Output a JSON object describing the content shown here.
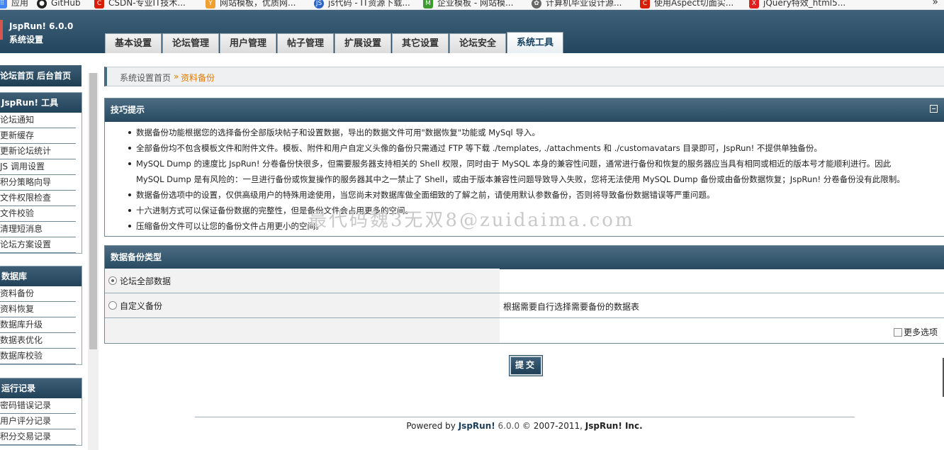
{
  "bookmarks": [
    {
      "label": "应用",
      "icon": "apps-icon",
      "color": "#4285f4"
    },
    {
      "label": "GitHub",
      "icon": "github-icon",
      "color": "#222222"
    },
    {
      "label": "CSDN-专业IT技术...",
      "icon": "csdn-icon",
      "color": "#d81e06"
    },
    {
      "label": "网站模板，优质网...",
      "icon": "template-icon",
      "color": "#f0a030"
    },
    {
      "label": "js代码 - IT资源下载...",
      "icon": "js-icon",
      "color": "#2b63c6"
    },
    {
      "label": "企业模板 - 网站模...",
      "icon": "m-icon",
      "color": "#3c9a2f"
    },
    {
      "label": "计算机毕业设计源...",
      "icon": "gear-icon",
      "color": "#666666"
    },
    {
      "label": "使用Aspect切面实...",
      "icon": "csdn-icon",
      "color": "#d81e06"
    },
    {
      "label": "jQuery特效_html5...",
      "icon": "jquery-icon",
      "color": "#e0201d"
    }
  ],
  "header": {
    "title": "JspRun! 6.0.0",
    "subtitle": "系统设置"
  },
  "tabs": [
    {
      "label": "基本设置",
      "active": false
    },
    {
      "label": "论坛管理",
      "active": false
    },
    {
      "label": "用户管理",
      "active": false
    },
    {
      "label": "帖子管理",
      "active": false
    },
    {
      "label": "扩展设置",
      "active": false
    },
    {
      "label": "其它设置",
      "active": false
    },
    {
      "label": "论坛安全",
      "active": false
    },
    {
      "label": "系统工具",
      "active": true
    }
  ],
  "sidebar": {
    "top_links": "论坛首页 后台首页",
    "sections": [
      {
        "title": "JspRun! 工具",
        "items": [
          "论坛通知",
          "更新缓存",
          "更新论坛统计",
          "JS 调用设置",
          "积分策略向导",
          "文件权限检查",
          "文件校验",
          "清理短消息",
          "论坛方案设置"
        ]
      },
      {
        "title": "数据库",
        "items": [
          "资料备份",
          "资料恢复",
          "数据库升级",
          "数据表优化",
          "数据库校验"
        ]
      },
      {
        "title": "运行记录",
        "items": [
          "密码错误记录",
          "用户评分记录",
          "积分交易记录"
        ]
      }
    ]
  },
  "breadcrumb": {
    "home": "系统设置首页",
    "separator": "»",
    "current": "资料备份"
  },
  "tips": {
    "title": "技巧提示",
    "items": [
      "数据备份功能根据您的选择备份全部版块帖子和设置数据，导出的数据文件可用\"数据恢复\"功能或 MySql 导入。",
      "全部备份均不包含模板文件和附件文件。模板、附件和用户自定义头像的备份只需通过 FTP 等下载 ./templates, ./attachments 和 ./customavatars 目录即可，JspRun! 不提供单独备份。",
      "MySQL Dump 的速度比 JspRun! 分卷备份快很多，但需要服务器支持相关的 Shell 权限，同时由于 MySQL 本身的兼容性问题，通常进行备份和恢复的服务器应当具有相同或相近的版本号才能顺利进行。因此",
      "数据备份选项中的设置，仅供高级用户的特殊用途使用，当您尚未对数据库做全面细致的了解之前，请使用默认参数备份，否则将导致备份数据错误等严重问题。",
      "十六进制方式可以保证备份数据的完整性，但是备份文件会占用更多的空间。",
      "压缩备份文件可以让您的备份文件占用更小的空间。"
    ],
    "item3_line2": "MySQL Dump 是有风险的：一旦进行备份或恢复操作的服务器其中之一禁止了 Shell，或由于版本兼容性问题导致导入失败，您将无法使用 MySQL Dump 备份或由备份数据恢复；JspRun! 分卷备份没有此限制。"
  },
  "backup": {
    "title": "数据备份类型",
    "options": [
      {
        "label": "论坛全部数据",
        "desc": "",
        "checked": true
      },
      {
        "label": "自定义备份",
        "desc": "根据需要自行选择需要备份的数据表",
        "checked": false
      }
    ],
    "more_options": "更多选项"
  },
  "submit_label": "提交",
  "footer": {
    "prefix": "Powered by",
    "brand": "JspRun!",
    "version": "6.0.0",
    "copyright": "© 2007-2011,",
    "company": "JspRun! Inc."
  },
  "watermark": "最代码魏3无双8@zuidaima.com"
}
